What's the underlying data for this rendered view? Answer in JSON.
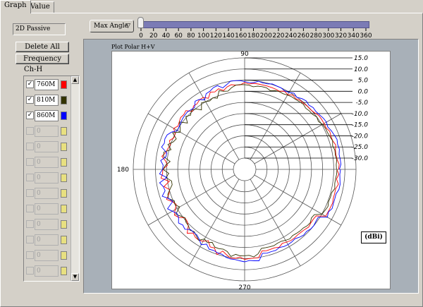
{
  "tabs": [
    {
      "label": "Graph",
      "active": true
    },
    {
      "label": "Value",
      "active": false
    }
  ],
  "mode_display": "2D Passive",
  "buttons": {
    "delete_all": "Delete All",
    "frequency": "Frequency"
  },
  "channel_header": "Ch-H",
  "channels": [
    {
      "checked": true,
      "value": "760M",
      "color": "#ff0000",
      "enabled": true
    },
    {
      "checked": true,
      "value": "810M",
      "color": "#333300",
      "enabled": true
    },
    {
      "checked": true,
      "value": "860M",
      "color": "#0000ff",
      "enabled": true
    },
    {
      "checked": false,
      "value": "0",
      "color": "#e8e080",
      "enabled": false
    },
    {
      "checked": false,
      "value": "0",
      "color": "#e8e080",
      "enabled": false
    },
    {
      "checked": false,
      "value": "0",
      "color": "#e8e080",
      "enabled": false
    },
    {
      "checked": false,
      "value": "0",
      "color": "#e8e080",
      "enabled": false
    },
    {
      "checked": false,
      "value": "0",
      "color": "#e8e080",
      "enabled": false
    },
    {
      "checked": false,
      "value": "0",
      "color": "#e8e080",
      "enabled": false
    },
    {
      "checked": false,
      "value": "0",
      "color": "#e8e080",
      "enabled": false
    },
    {
      "checked": false,
      "value": "0",
      "color": "#e8e080",
      "enabled": false
    },
    {
      "checked": false,
      "value": "0",
      "color": "#e8e080",
      "enabled": false
    },
    {
      "checked": false,
      "value": "0",
      "color": "#e8e080",
      "enabled": false
    }
  ],
  "angle_control": {
    "label": "Max Angle",
    "dropdown_icon": "triangle-down-icon",
    "slider_value": 0,
    "scale_ticks": [
      "0",
      "20",
      "40",
      "60",
      "80",
      "100",
      "120",
      "140",
      "160",
      "180",
      "200",
      "220",
      "240",
      "260",
      "280",
      "300",
      "320",
      "340",
      "360"
    ]
  },
  "plot": {
    "title": "Plot Polar H+V",
    "angle_labels": {
      "top": "90",
      "left": "180",
      "bottom": "270"
    },
    "ring_labels": [
      "15.0",
      "10.0",
      "5.0",
      "0.0",
      "-5.0",
      "-10.0",
      "-15.0",
      "-20.0",
      "-25.0",
      "-30.0"
    ],
    "unit": "(dBi)"
  }
}
